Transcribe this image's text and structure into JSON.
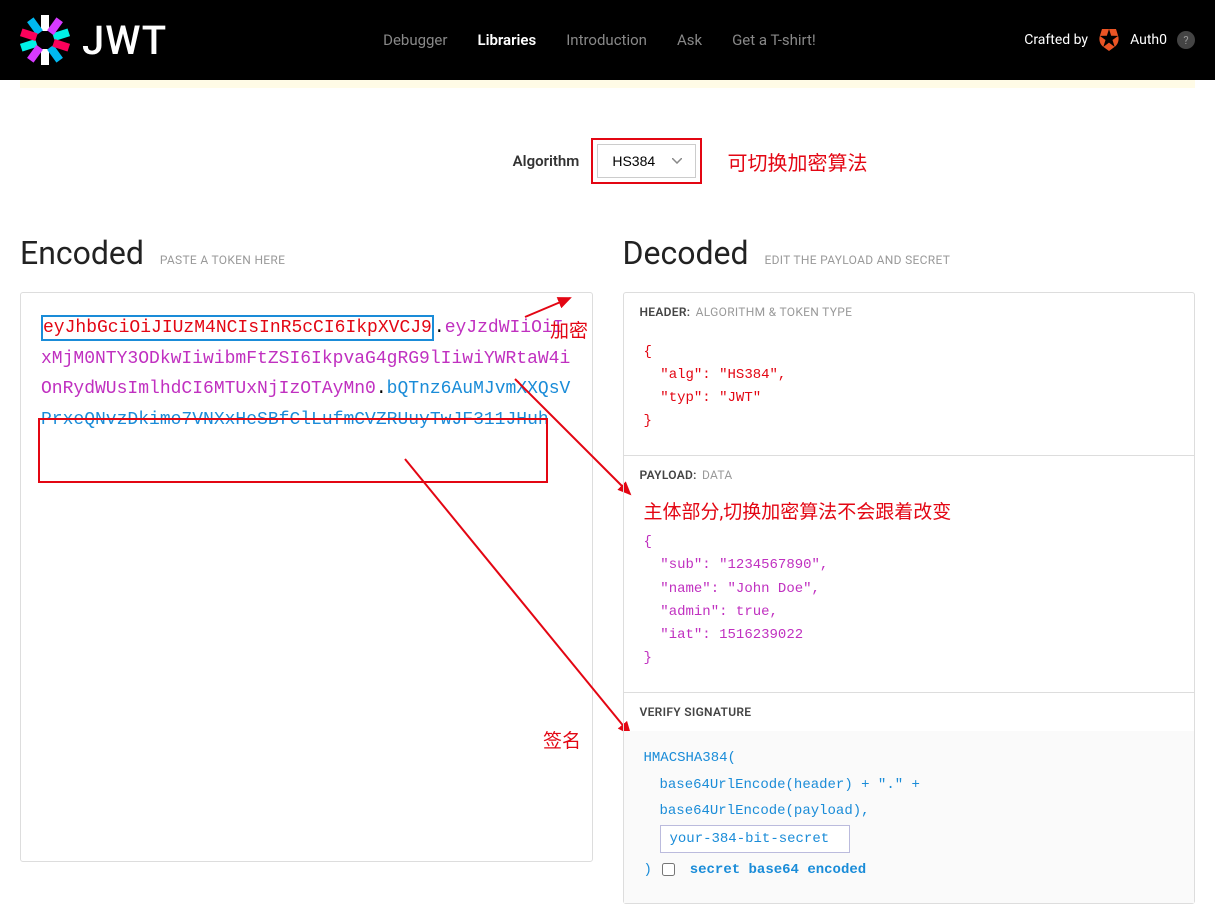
{
  "nav": {
    "logo_text": "JWT",
    "links": [
      "Debugger",
      "Libraries",
      "Introduction",
      "Ask",
      "Get a T-shirt!"
    ],
    "active_index": 1,
    "crafted_by": "Crafted by",
    "auth0": "Auth0",
    "help": "?"
  },
  "algorithm": {
    "label": "Algorithm",
    "value": "HS384",
    "annotation": "可切换加密算法"
  },
  "encoded": {
    "title": "Encoded",
    "subtitle": "PASTE A TOKEN HERE",
    "token_header": "eyJhbGciOiJIUzM4NCIsInR5cCI6IkpXVCJ9",
    "token_payload": "eyJzdWIiOiIxMjM0NTY3ODkwIiwibmFtZSI6IkpvaG4gRG9lIiwiYWRtaW4iOnRydWUsImlhdCI6MTUxNjIzOTAyMn0",
    "token_sig": "bQTnz6AuMJvmXXQsVPrxeQNvzDkimo7VNXxHeSBfClLufmCVZRUuyTwJF311JHuh",
    "dot": "."
  },
  "decoded": {
    "title": "Decoded",
    "subtitle": "EDIT THE PAYLOAD AND SECRET",
    "header_label": "HEADER:",
    "header_sub": "ALGORITHM & TOKEN TYPE",
    "header_json": "{\n  \"alg\": \"HS384\",\n  \"typ\": \"JWT\"\n}",
    "payload_label": "PAYLOAD:",
    "payload_sub": "DATA",
    "payload_annotation": "主体部分,切换加密算法不会跟着改变",
    "payload_json": "{\n  \"sub\": \"1234567890\",\n  \"name\": \"John Doe\",\n  \"admin\": true,\n  \"iat\": 1516239022\n}",
    "verify_label": "VERIFY SIGNATURE",
    "sig_func": "HMACSHA384(",
    "sig_line1": "base64UrlEncode(header) + \".\" +",
    "sig_line2": "base64UrlEncode(payload),",
    "sig_secret_value": "your-384-bit-secret",
    "sig_close": ")",
    "sig_checkbox_label": "secret base64 encoded"
  },
  "annotations": {
    "encrypt": "加密",
    "signature": "签名"
  }
}
